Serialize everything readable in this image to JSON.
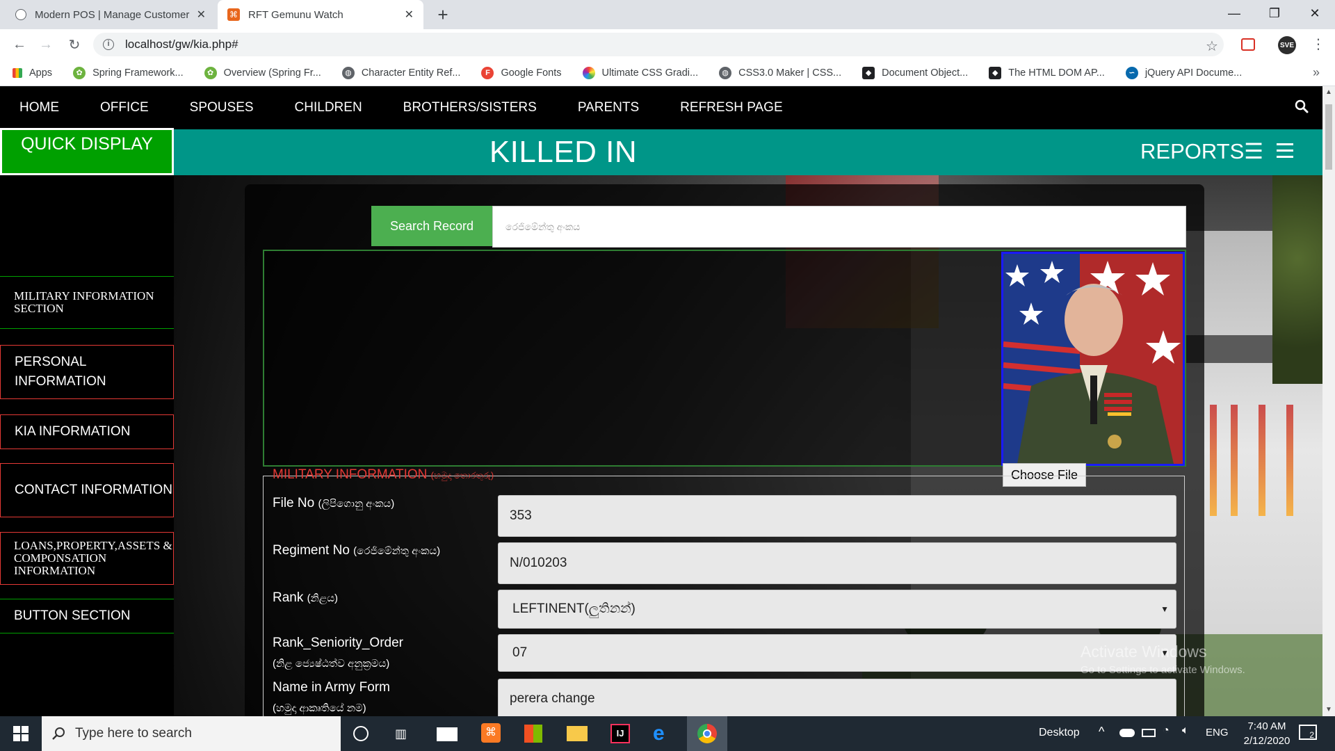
{
  "browser": {
    "tabs": [
      {
        "title": "Modern POS | Manage Customer",
        "icon": "globe-icon",
        "active": false
      },
      {
        "title": "RFT Gemunu Watch",
        "icon": "site-favicon",
        "active": true
      }
    ],
    "new_tab": "+",
    "url": "localhost/gw/kia.php#",
    "window_controls": {
      "minimize": "—",
      "restore": "❐",
      "close": "✕"
    },
    "bookmarks": [
      {
        "label": "Apps",
        "icon": "apps-grid-icon"
      },
      {
        "label": "Spring Framework...",
        "icon": "spring-icon"
      },
      {
        "label": "Overview (Spring Fr...",
        "icon": "spring-icon"
      },
      {
        "label": "Character Entity Ref...",
        "icon": "globe-icon"
      },
      {
        "label": "Google Fonts",
        "icon": "google-fonts-icon"
      },
      {
        "label": "Ultimate CSS Gradi...",
        "icon": "gradient-icon"
      },
      {
        "label": "CSS3.0 Maker | CSS...",
        "icon": "globe-icon"
      },
      {
        "label": "Document Object...",
        "icon": "dom-icon"
      },
      {
        "label": "The HTML DOM AP...",
        "icon": "dom-icon"
      },
      {
        "label": "jQuery API Docume...",
        "icon": "jquery-icon"
      }
    ],
    "bookmarks_more": "»"
  },
  "page": {
    "nav": [
      "HOME",
      "OFFICE",
      "SPOUSES",
      "CHILDREN",
      "BROTHERS/SISTERS",
      "PARENTS",
      "REFRESH PAGE"
    ],
    "banner_title": "KILLED IN ACTION",
    "quick_display": "QUICK DISPLAY",
    "reports": "REPORTS☰",
    "sidebar": [
      "MILITARY INFORMATION SECTION",
      "PERSONAL INFORMATION",
      "KIA INFORMATION",
      "CONTACT INFORMATION",
      "LOANS,PROPERTY,ASSETS & COMPONSATION INFORMATION",
      "BUTTON SECTION"
    ],
    "search": {
      "button": "Search Record",
      "placeholder": "රෙජිමේන්තු අංකය"
    },
    "choose_file": "Choose File",
    "section_legend": "MILITARY INFORMATION",
    "section_legend_si": "(හමුදා තොරතුරු)",
    "fields": [
      {
        "label": "File No",
        "label_si": "(ලිපිගොනු අංකය)",
        "value": "353"
      },
      {
        "label": "Regiment No",
        "label_si": "(රෙජිමේන්තු අංකය)",
        "value": "N/010203"
      },
      {
        "label": "Rank",
        "label_si": "(නිළය)",
        "value": "LEFTINENT(ලුතිනන්)"
      },
      {
        "label": "Rank_Seniority_Order",
        "label_si": "(නිළ ජ්‍යෙෂ්ඨත්ව අනුක්‍රමය)",
        "value": "07"
      },
      {
        "label": "Name in Army Form",
        "label_si": "(හමුදා ආකෘතියේ නම)",
        "value": "perera change"
      }
    ],
    "watermark": {
      "line1": "Activate Windows",
      "line2": "Go to Settings to activate Windows."
    }
  },
  "taskbar": {
    "search_placeholder": "Type here to search",
    "desktop": "Desktop",
    "language": "ENG",
    "time": "7:40 AM",
    "date": "2/12/2020",
    "notification_count": "2"
  },
  "colors": {
    "teal_banner": "#009688",
    "quick_display_green": "#00a000",
    "search_button": "#4caf50",
    "legend_red": "#e53935",
    "photo_border": "#1a1aff"
  }
}
